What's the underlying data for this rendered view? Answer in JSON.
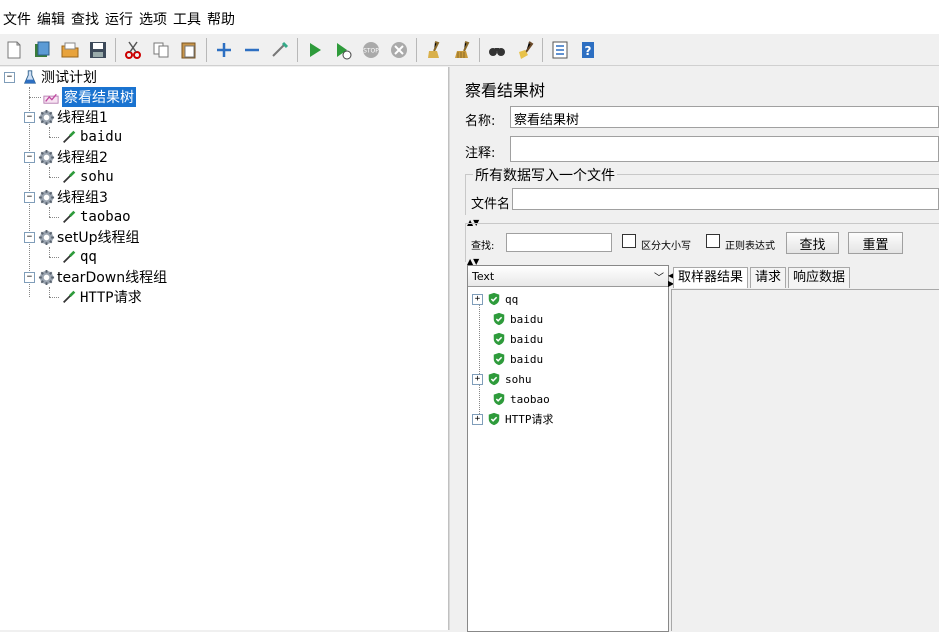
{
  "menu": [
    "文件",
    "编辑",
    "查找",
    "运行",
    "选项",
    "工具",
    "帮助"
  ],
  "toolbar_icons": [
    "new-file-icon",
    "templates-icon",
    "open-icon",
    "save-icon",
    "cut-icon",
    "copy-icon",
    "paste-icon",
    "expand-icon",
    "collapse-icon",
    "toggle-icon",
    "start-icon",
    "start-no-pause-icon",
    "stop-icon",
    "shutdown-icon",
    "clear-icon",
    "clear-all-icon",
    "search-icon",
    "reset-search-icon",
    "function-helper-icon",
    "help-icon"
  ],
  "tree": [
    {
      "label": "测试计划",
      "level": 0,
      "icon": "test-plan-icon",
      "selected": false,
      "mono": false
    },
    {
      "label": "察看结果树",
      "level": 1,
      "icon": "listener-icon",
      "selected": true,
      "mono": false
    },
    {
      "label": "线程组1",
      "level": 1,
      "icon": "thread-group-icon",
      "selected": false,
      "mono": false
    },
    {
      "label": "baidu",
      "level": 2,
      "icon": "sampler-icon",
      "selected": false,
      "mono": true
    },
    {
      "label": "线程组2",
      "level": 1,
      "icon": "thread-group-icon",
      "selected": false,
      "mono": false
    },
    {
      "label": "sohu",
      "level": 2,
      "icon": "sampler-icon",
      "selected": false,
      "mono": true
    },
    {
      "label": "线程组3",
      "level": 1,
      "icon": "thread-group-icon",
      "selected": false,
      "mono": false
    },
    {
      "label": "taobao",
      "level": 2,
      "icon": "sampler-icon",
      "selected": false,
      "mono": true
    },
    {
      "label": "setUp线程组",
      "level": 1,
      "icon": "thread-group-icon",
      "selected": false,
      "mono": false
    },
    {
      "label": "qq",
      "level": 2,
      "icon": "sampler-icon",
      "selected": false,
      "mono": true
    },
    {
      "label": "tearDown线程组",
      "level": 1,
      "icon": "thread-group-icon",
      "selected": false,
      "mono": false
    },
    {
      "label": "HTTP请求",
      "level": 2,
      "icon": "sampler-icon",
      "selected": false,
      "mono": true
    }
  ],
  "panel": {
    "title": "察看结果树",
    "name_label": "名称:",
    "name_value": "察看结果树",
    "comment_label": "注释:",
    "comment_value": "",
    "file_group_title": "所有数据写入一个文件",
    "filename_label": "文件名",
    "filename_value": ""
  },
  "search": {
    "label": "查找:",
    "value": "",
    "case_label": "区分大小写",
    "regex_label": "正则表达式",
    "find_button": "查找",
    "reset_button": "重置"
  },
  "results": {
    "renderer": "Text",
    "items": [
      {
        "label": "qq",
        "expandable": true
      },
      {
        "label": "baidu",
        "expandable": false
      },
      {
        "label": "baidu",
        "expandable": false
      },
      {
        "label": "baidu",
        "expandable": false
      },
      {
        "label": "sohu",
        "expandable": true
      },
      {
        "label": "taobao",
        "expandable": false
      },
      {
        "label": "HTTP请求",
        "expandable": true
      }
    ]
  },
  "tabs": [
    "取样器结果",
    "请求",
    "响应数据"
  ]
}
